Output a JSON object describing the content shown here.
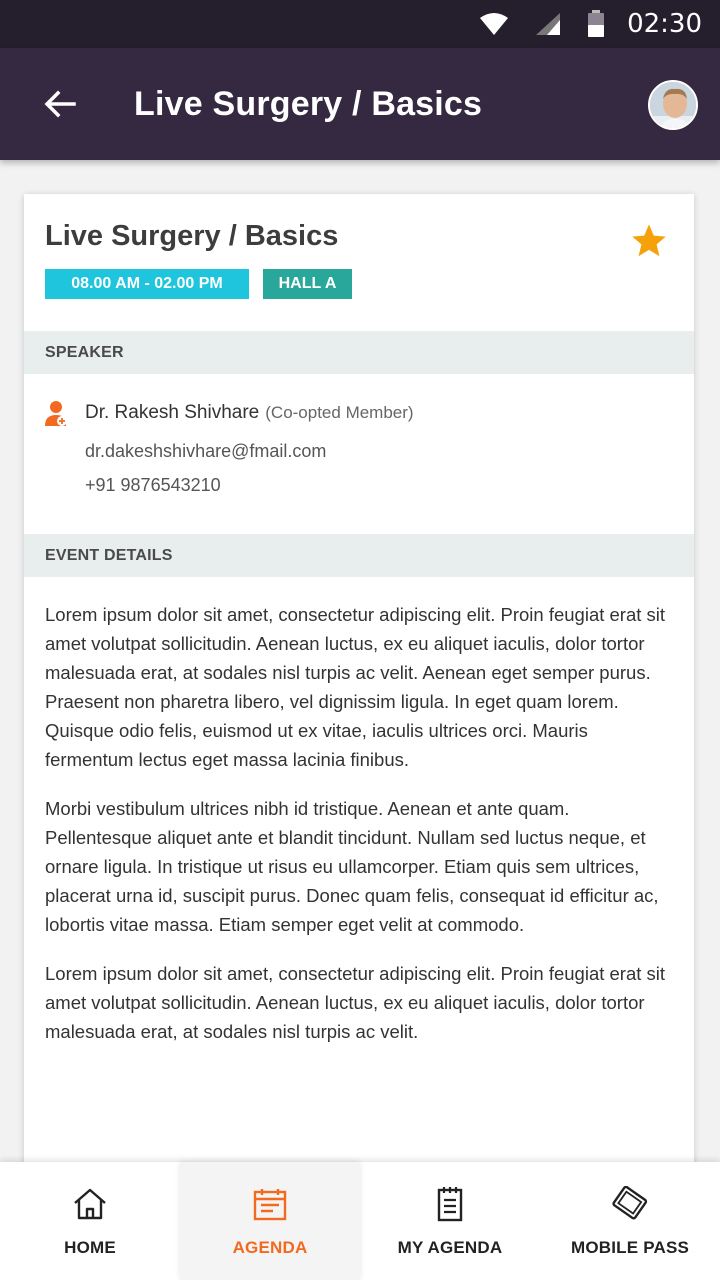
{
  "status_bar": {
    "time": "02:30"
  },
  "app_bar": {
    "title": "Live Surgery / Basics"
  },
  "event": {
    "title": "Live Surgery / Basics",
    "time_tag": "08.00 AM - 02.00 PM",
    "hall_tag": "HALL A",
    "favorite": true
  },
  "speaker_section": {
    "header": "SPEAKER",
    "name": "Dr. Rakesh Shivhare",
    "role": "(Co-opted Member)",
    "email": "dr.dakeshshivhare@fmail.com",
    "phone": "+91 9876543210"
  },
  "details_section": {
    "header": "EVENT DETAILS",
    "paragraphs": [
      "Lorem ipsum dolor sit amet, consectetur adipiscing elit. Proin feugiat erat sit amet volutpat sollicitudin. Aenean luctus, ex eu aliquet iaculis, dolor tortor malesuada erat, at sodales nisl turpis ac velit. Aenean eget semper purus. Praesent non pharetra libero, vel dignissim ligula. In eget quam lorem. Quisque odio felis, euismod ut ex vitae, iaculis ultrices orci. Mauris fermentum lectus eget massa lacinia finibus.",
      "Morbi vestibulum ultrices nibh id tristique. Aenean et ante quam. Pellentesque aliquet ante et blandit tincidunt. Nullam sed luctus neque, et ornare ligula. In tristique ut risus eu ullamcorper. Etiam quis sem ultrices, placerat urna id, suscipit purus. Donec quam felis, consequat id efficitur ac, lobortis vitae massa. Etiam semper eget velit at commodo.",
      "Lorem ipsum dolor sit amet, consectetur adipiscing elit. Proin feugiat erat sit amet volutpat sollicitudin. Aenean luctus, ex eu aliquet iaculis, dolor tortor malesuada erat, at sodales nisl turpis ac velit."
    ]
  },
  "bottom_nav": {
    "items": [
      {
        "label": "HOME",
        "icon": "home-icon",
        "active": false
      },
      {
        "label": "AGENDA",
        "icon": "calendar-icon",
        "active": true
      },
      {
        "label": "MY AGENDA",
        "icon": "notepad-icon",
        "active": false
      },
      {
        "label": "MOBILE PASS",
        "icon": "ticket-icon",
        "active": false
      }
    ]
  },
  "colors": {
    "status_bar": "#251e2d",
    "app_bar": "#352841",
    "time_tag": "#1ec5dc",
    "hall_tag": "#2aa79b",
    "star": "#f5a20a",
    "accent": "#f26a1f"
  }
}
